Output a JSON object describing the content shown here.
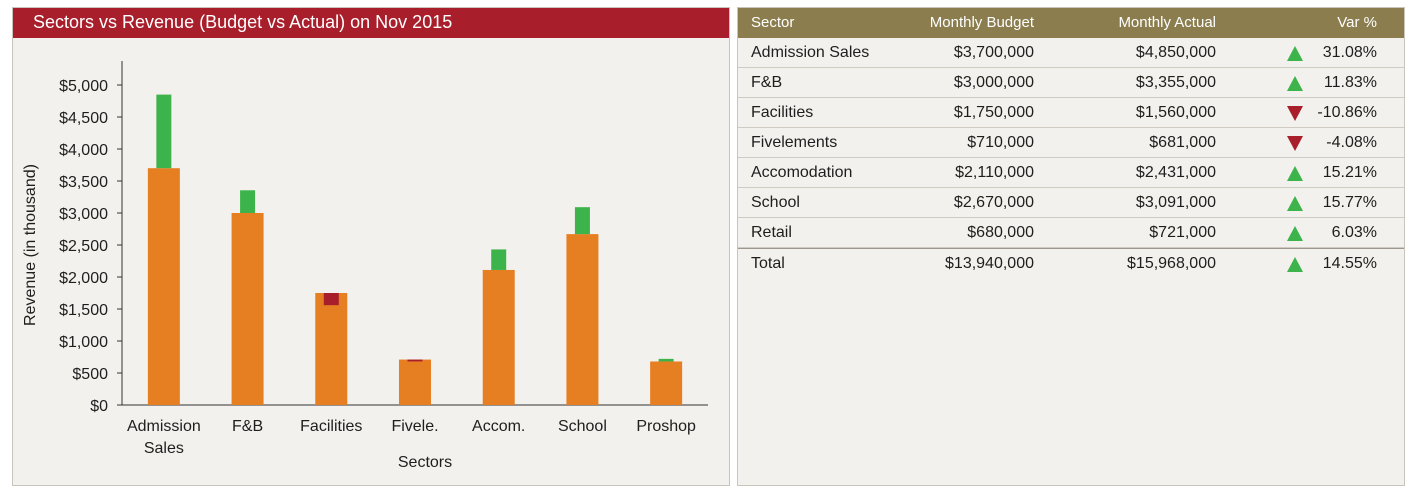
{
  "chart_panel": {
    "title": "Sectors vs Revenue (Budget vs Actual) on Nov 2015"
  },
  "chart_data": {
    "type": "bar",
    "categories": [
      "Admission Sales",
      "F&B",
      "Facilities",
      "Fivele.",
      "Accom.",
      "School",
      "Proshop"
    ],
    "series": [
      {
        "name": "Budget",
        "values": [
          3700,
          3000,
          1750,
          710,
          2110,
          2670,
          680
        ]
      },
      {
        "name": "Actual",
        "values": [
          4850,
          3355,
          1560,
          681,
          2431,
          3091,
          721
        ]
      }
    ],
    "xlabel": "Sectors",
    "ylabel": "Revenue (in thousand)",
    "ylim": [
      0,
      5000
    ],
    "yticks": [
      "$0",
      "$500",
      "$1,000",
      "$1,500",
      "$2,000",
      "$2,500",
      "$3,000",
      "$3,500",
      "$4,000",
      "$4,500",
      "$5,000"
    ],
    "ytick_values": [
      0,
      500,
      1000,
      1500,
      2000,
      2500,
      3000,
      3500,
      4000,
      4500,
      5000
    ],
    "colors": {
      "budget": "#e67e22",
      "over": "#3cb44b",
      "under": "#a81e2b",
      "axis": "#333333"
    }
  },
  "table": {
    "headers": {
      "sector": "Sector",
      "budget": "Monthly Budget",
      "actual": "Monthly Actual",
      "var": "Var %"
    },
    "rows": [
      {
        "sector": "Admission Sales",
        "budget": "$3,700,000",
        "actual": "$4,850,000",
        "var": "31.08%",
        "dir": "up-arrow-icon"
      },
      {
        "sector": "F&B",
        "budget": "$3,000,000",
        "actual": "$3,355,000",
        "var": "11.83%",
        "dir": "up-arrow-icon"
      },
      {
        "sector": "Facilities",
        "budget": "$1,750,000",
        "actual": "$1,560,000",
        "var": "-10.86%",
        "dir": "down-arrow-icon"
      },
      {
        "sector": "Fivelements",
        "budget": "$710,000",
        "actual": "$681,000",
        "var": "-4.08%",
        "dir": "down-arrow-icon"
      },
      {
        "sector": "Accomodation",
        "budget": "$2,110,000",
        "actual": "$2,431,000",
        "var": "15.21%",
        "dir": "up-arrow-icon"
      },
      {
        "sector": "School",
        "budget": "$2,670,000",
        "actual": "$3,091,000",
        "var": "15.77%",
        "dir": "up-arrow-icon"
      },
      {
        "sector": "Retail",
        "budget": "$680,000",
        "actual": "$721,000",
        "var": "6.03%",
        "dir": "up-arrow-icon"
      }
    ],
    "total": {
      "sector": "Total",
      "budget": "$13,940,000",
      "actual": "$15,968,000",
      "var": "14.55%",
      "dir": "up-arrow-icon"
    },
    "colors": {
      "header_bg": "#8b7d4e",
      "up": "#3cb44b",
      "down": "#a81e2b"
    }
  }
}
